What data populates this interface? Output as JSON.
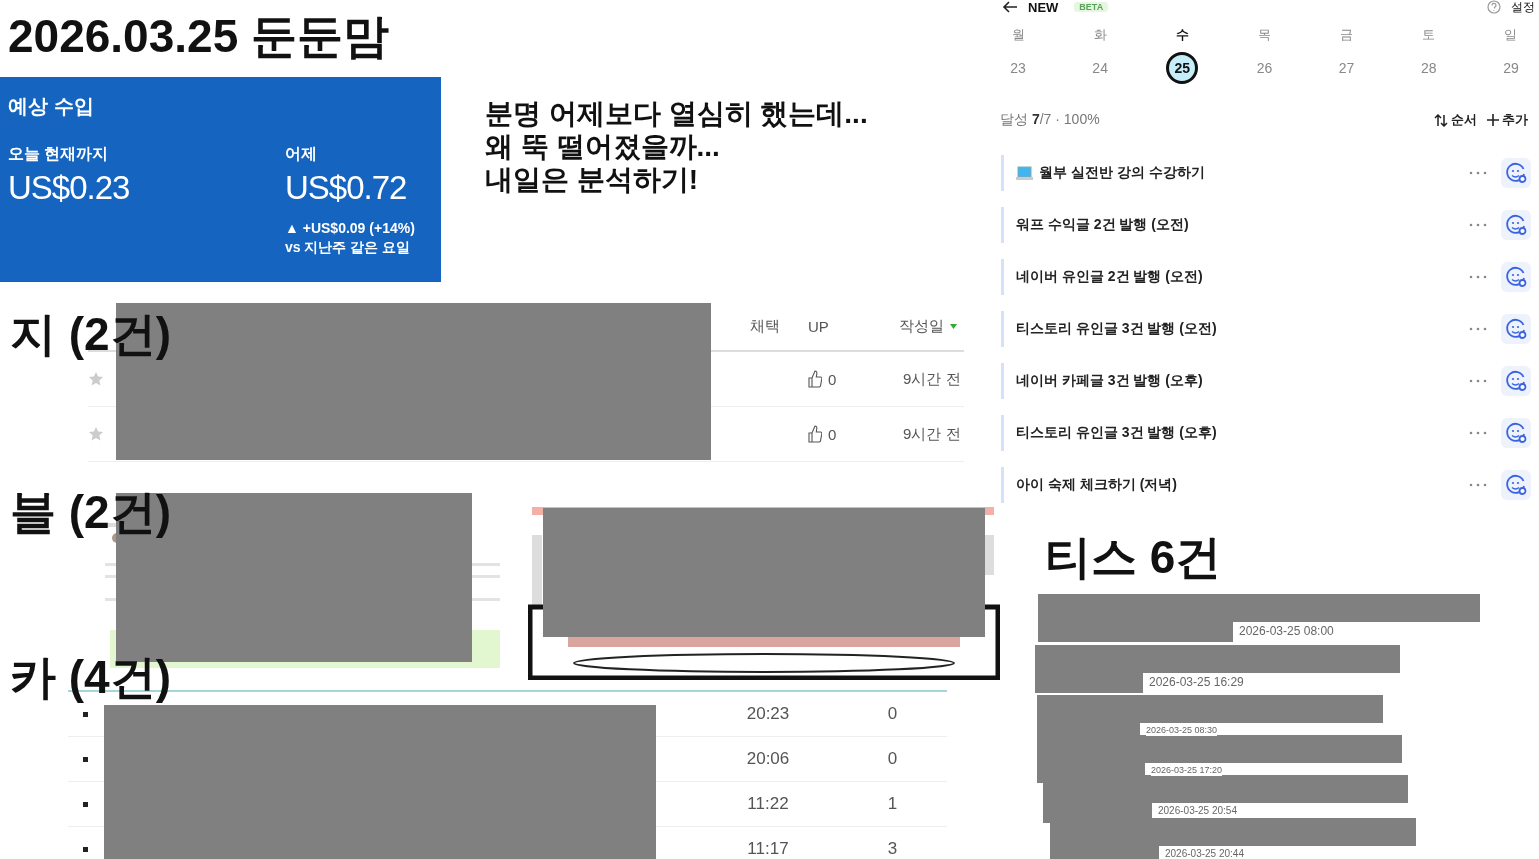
{
  "title": "2026.03.25 둔둔맘",
  "earnings": {
    "heading": "예상 수입",
    "today_label": "오늘 현재까지",
    "today_value": "US$0.23",
    "yesterday_label": "어제",
    "yesterday_value": "US$0.72",
    "change": "▲ +US$0.09 (+14%)",
    "compare": "vs 지난주 같은 요일"
  },
  "note": {
    "lines": [
      "분명 어제보다 열심히 했는데...",
      "왜 뚝 떨어졌을까...",
      "내일은 분석하기!"
    ]
  },
  "habit": {
    "title": "NEW",
    "badge": "BETA",
    "settings": "설정",
    "days": [
      {
        "weekday": "월",
        "date": "23",
        "selected": false
      },
      {
        "weekday": "화",
        "date": "24",
        "selected": false
      },
      {
        "weekday": "수",
        "date": "25",
        "selected": true
      },
      {
        "weekday": "목",
        "date": "26",
        "selected": false
      },
      {
        "weekday": "금",
        "date": "27",
        "selected": false
      },
      {
        "weekday": "토",
        "date": "28",
        "selected": false
      },
      {
        "weekday": "일",
        "date": "29",
        "selected": false
      }
    ],
    "progress": "달성 **7**/7 · 100%",
    "actions": [
      {
        "kind": "sort",
        "label": "순서"
      },
      {
        "kind": "add",
        "label": "추가"
      }
    ],
    "tasks": [
      {
        "label": "월부 실전반 강의 수강하기",
        "has_icon": true
      },
      {
        "label": "워프 수익글 2건 발행 (오전)",
        "has_icon": false
      },
      {
        "label": "네이버 유인글 2건 발행 (오전)",
        "has_icon": false
      },
      {
        "label": "티스토리 유인글 3건 발행 (오전)",
        "has_icon": false
      },
      {
        "label": "네이버 카페글 3건 발행 (오후)",
        "has_icon": false
      },
      {
        "label": "티스토리 유인글 3건 발행 (오후)",
        "has_icon": false
      },
      {
        "label": "아이 숙제 체크하기 (저녁)",
        "has_icon": false
      }
    ]
  },
  "ji": {
    "heading": "지 (2건)",
    "columns": [
      {
        "label": "채택",
        "sorted": false
      },
      {
        "label": "UP",
        "sorted": false
      },
      {
        "label": "작성일",
        "sorted": true
      }
    ],
    "rows": [
      {
        "up": "0",
        "date": "9시간 전"
      },
      {
        "up": "0",
        "date": "9시간 전"
      }
    ]
  },
  "blog": {
    "heading": "블 (2건)"
  },
  "cafe": {
    "heading": "카 (4건)",
    "rows": [
      {
        "time": "20:23",
        "count": "0"
      },
      {
        "time": "20:06",
        "count": "0"
      },
      {
        "time": "11:22",
        "count": "1"
      },
      {
        "time": "11:17",
        "count": "3"
      }
    ]
  },
  "tistory": {
    "heading": "티스 6건",
    "posts": [
      {
        "date": "2026-03-25 08:00"
      },
      {
        "date": "2026-03-25 16:29"
      },
      {
        "date": "2026-03-25 08:30"
      },
      {
        "date": "2026-03-25 17:20"
      },
      {
        "date": "2026-03-25 20:54"
      },
      {
        "date": "2026-03-25 20:44"
      }
    ]
  }
}
